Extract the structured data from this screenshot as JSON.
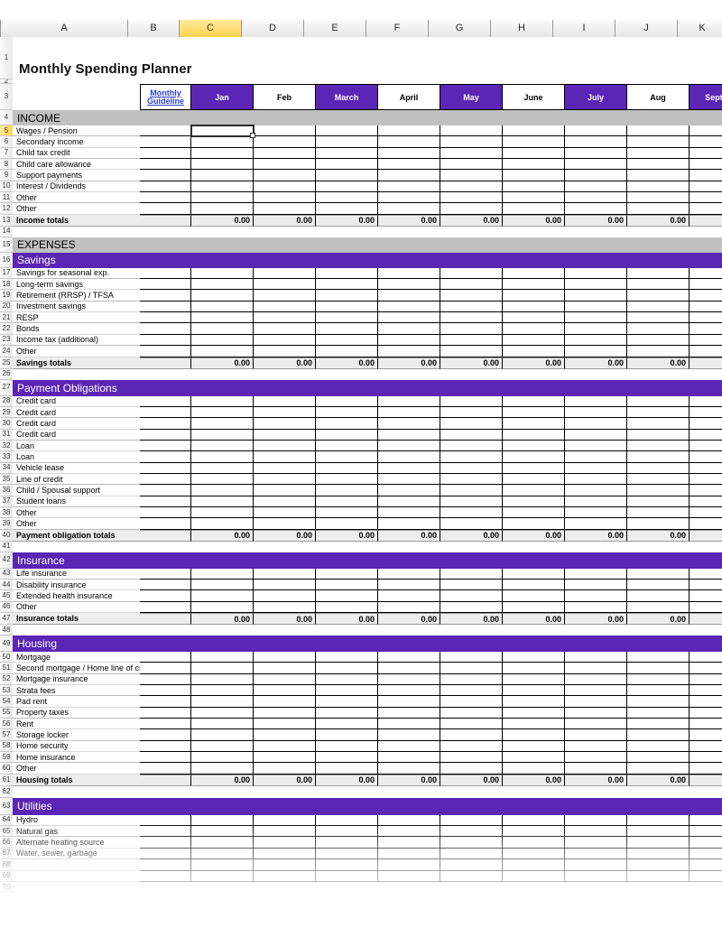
{
  "app": {
    "type": "spreadsheet",
    "title": "Monthly Spending Planner",
    "accent_purple": "#5B25B5",
    "section_gray": "#C0C0C0",
    "totals_gray": "#EDEDED",
    "active_header_yellow": "#FFD24D",
    "link_blue": "#2A3FD4"
  },
  "column_headers": [
    "A",
    "B",
    "C",
    "D",
    "E",
    "F",
    "G",
    "H",
    "I",
    "J",
    "K"
  ],
  "active_column": "C",
  "active_row": "5",
  "selected_cell": "C5",
  "month_header": {
    "guideline_line1": "Monthly ",
    "guideline_line2": "Guideline",
    "months": [
      {
        "label": "Jan",
        "style": "purple"
      },
      {
        "label": "Feb",
        "style": "white"
      },
      {
        "label": "March",
        "style": "purple"
      },
      {
        "label": "April",
        "style": "white"
      },
      {
        "label": "May",
        "style": "purple"
      },
      {
        "label": "June",
        "style": "white"
      },
      {
        "label": "July",
        "style": "purple"
      },
      {
        "label": "Aug",
        "style": "white"
      },
      {
        "label": "Sept",
        "style": "purple"
      }
    ]
  },
  "banners": {
    "income": "INCOME",
    "expenses": "EXPENSES"
  },
  "total_value": "0.00",
  "sections": [
    {
      "id": "income",
      "banner": "INCOME",
      "banner_style": "gray",
      "rows": [
        {
          "row": 5,
          "label": "Wages / Pension"
        },
        {
          "row": 6,
          "label": "Secondary income"
        },
        {
          "row": 7,
          "label": "Child tax credit"
        },
        {
          "row": 8,
          "label": "Child care allowance"
        },
        {
          "row": 9,
          "label": "Support payments"
        },
        {
          "row": 10,
          "label": "Interest / Dividends"
        },
        {
          "row": 11,
          "label": "Other"
        },
        {
          "row": 12,
          "label": "Other"
        }
      ],
      "totals": {
        "row": 13,
        "label": "Income totals"
      }
    },
    {
      "id": "savings",
      "banner": "Savings",
      "banner_style": "purple",
      "banner_row": 16,
      "rows": [
        {
          "row": 17,
          "label": "Savings for seasonal exp."
        },
        {
          "row": 18,
          "label": "Long-term savings"
        },
        {
          "row": 19,
          "label": "Retirement (RRSP) / TFSA"
        },
        {
          "row": 20,
          "label": "Investment savings"
        },
        {
          "row": 21,
          "label": "RESP"
        },
        {
          "row": 22,
          "label": "Bonds"
        },
        {
          "row": 23,
          "label": "Income tax (additional)"
        },
        {
          "row": 24,
          "label": "Other"
        }
      ],
      "totals": {
        "row": 25,
        "label": "Savings totals"
      }
    },
    {
      "id": "payment-obligations",
      "banner": "Payment Obligations",
      "banner_style": "purple",
      "banner_row": 27,
      "rows": [
        {
          "row": 28,
          "label": "Credit card"
        },
        {
          "row": 29,
          "label": "Credit card"
        },
        {
          "row": 30,
          "label": "Credit card"
        },
        {
          "row": 31,
          "label": "Credit card"
        },
        {
          "row": 32,
          "label": "Loan"
        },
        {
          "row": 33,
          "label": "Loan"
        },
        {
          "row": 34,
          "label": "Vehicle lease"
        },
        {
          "row": 35,
          "label": "Line of credit"
        },
        {
          "row": 36,
          "label": "Child / Spousal support"
        },
        {
          "row": 37,
          "label": "Student loans"
        },
        {
          "row": 38,
          "label": "Other"
        },
        {
          "row": 39,
          "label": "Other"
        }
      ],
      "totals": {
        "row": 40,
        "label": "Payment obligation totals"
      }
    },
    {
      "id": "insurance",
      "banner": "Insurance",
      "banner_style": "purple",
      "banner_row": 42,
      "rows": [
        {
          "row": 43,
          "label": "Life insurance"
        },
        {
          "row": 44,
          "label": "Disability insurance"
        },
        {
          "row": 45,
          "label": "Extended health insurance"
        },
        {
          "row": 46,
          "label": "Other"
        }
      ],
      "totals": {
        "row": 47,
        "label": "Insurance totals"
      }
    },
    {
      "id": "housing",
      "banner": "Housing",
      "banner_style": "purple",
      "banner_row": 49,
      "rows": [
        {
          "row": 50,
          "label": "Mortgage"
        },
        {
          "row": 51,
          "label": "Second mortgage / Home line of credit"
        },
        {
          "row": 52,
          "label": "Mortgage insurance"
        },
        {
          "row": 53,
          "label": "Strata fees"
        },
        {
          "row": 54,
          "label": "Pad rent"
        },
        {
          "row": 55,
          "label": "Property taxes"
        },
        {
          "row": 56,
          "label": "Rent"
        },
        {
          "row": 57,
          "label": "Storage locker"
        },
        {
          "row": 58,
          "label": "Home security"
        },
        {
          "row": 59,
          "label": "Home insurance"
        },
        {
          "row": 60,
          "label": "Other"
        }
      ],
      "totals": {
        "row": 61,
        "label": "Housing totals"
      }
    },
    {
      "id": "utilities",
      "banner": "Utilities",
      "banner_style": "purple",
      "banner_row": 63,
      "rows": [
        {
          "row": 64,
          "label": "Hydro"
        },
        {
          "row": 65,
          "label": "Natural gas"
        },
        {
          "row": 66,
          "label": "Alternate heating source"
        },
        {
          "row": 67,
          "label": "Water, sewer, garbage"
        }
      ],
      "totals": null
    }
  ]
}
